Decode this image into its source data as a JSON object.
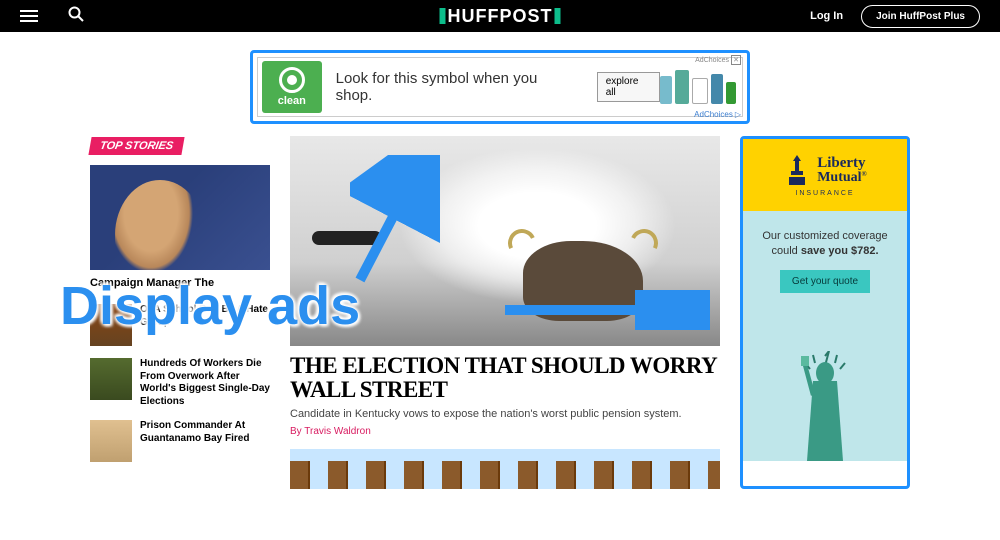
{
  "header": {
    "logo_text": "HUFFPOST",
    "login": "Log In",
    "join": "Join HuffPost Plus"
  },
  "leaderboard_ad": {
    "badge": "clean",
    "headline": "Look for this symbol when you shop.",
    "cta": "explore all",
    "adchoices_top": "AdChoices",
    "adchoices_bottom": "AdChoices"
  },
  "top_stories_label": "TOP STORIES",
  "lead_story": {
    "title": "Campaign Manager The"
  },
  "side_stories": [
    {
      "title": "Of A School Run By A Hate Group"
    },
    {
      "title": "Hundreds Of Workers Die From Overwork After World's Biggest Single-Day Elections"
    },
    {
      "title": "Prison Commander At Guantanamo Bay Fired"
    }
  ],
  "hero": {
    "title": "THE ELECTION THAT SHOULD WORRY WALL STREET",
    "subtitle": "Candidate in Kentucky vows to expose the nation's worst public pension system.",
    "byline": "By Travis Waldron"
  },
  "right_ad": {
    "brand_line1": "Liberty",
    "brand_line2": "Mutual",
    "brand_sub": "INSURANCE",
    "copy_line1": "Our customized coverage",
    "copy_line2_pre": "could ",
    "copy_line2_strong": "save you $782.",
    "cta": "Get your quote",
    "close": "✕"
  },
  "annotation": "Display ads"
}
